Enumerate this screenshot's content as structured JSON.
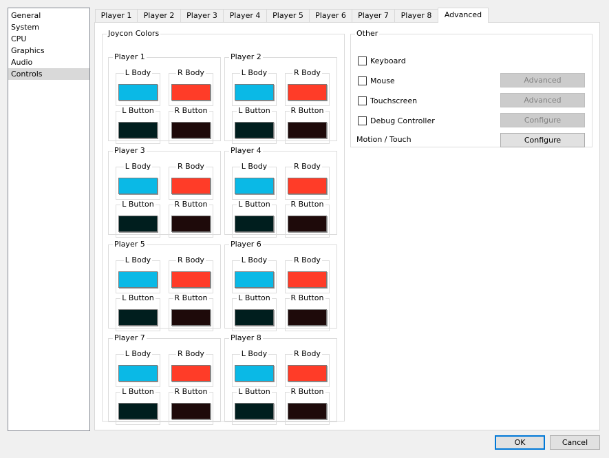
{
  "sidebar": {
    "items": [
      {
        "label": "General"
      },
      {
        "label": "System"
      },
      {
        "label": "CPU"
      },
      {
        "label": "Graphics"
      },
      {
        "label": "Audio"
      },
      {
        "label": "Controls",
        "selected": true
      }
    ]
  },
  "tabs": [
    "Player 1",
    "Player 2",
    "Player 3",
    "Player 4",
    "Player 5",
    "Player 6",
    "Player 7",
    "Player 8",
    "Advanced"
  ],
  "active_tab": "Advanced",
  "joycon": {
    "title": "Joycon Colors",
    "labels": {
      "l_body": "L Body",
      "r_body": "R Body",
      "l_button": "L Button",
      "r_button": "R Button"
    },
    "colors": {
      "l_body": "#0ab9e6",
      "r_body": "#ff3c28",
      "l_button": "#001e1e",
      "r_button": "#1e0a0a"
    },
    "players": [
      "Player 1",
      "Player 2",
      "Player 3",
      "Player 4",
      "Player 5",
      "Player 6",
      "Player 7",
      "Player 8"
    ]
  },
  "other": {
    "title": "Other",
    "keyboard": "Keyboard",
    "mouse": "Mouse",
    "mouse_button": "Advanced",
    "touchscreen": "Touchscreen",
    "touchscreen_button": "Advanced",
    "debug_controller": "Debug Controller",
    "debug_button": "Configure",
    "motion_touch": "Motion / Touch",
    "motion_button": "Configure"
  },
  "dialog": {
    "ok": "OK",
    "cancel": "Cancel"
  }
}
